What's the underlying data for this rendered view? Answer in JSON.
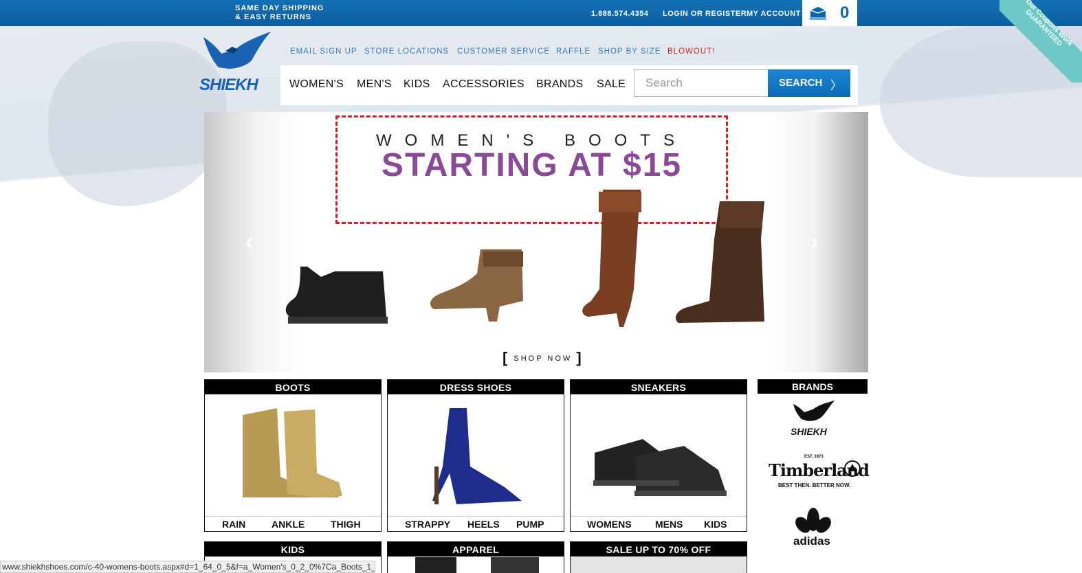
{
  "topbar": {
    "shipping_line1": "SAME DAY SHIPPING",
    "shipping_line2": "& EASY RETURNS",
    "phone": "1.888.574.4354",
    "login": "LOGIN OR REGISTER",
    "account": "MY ACCOUNT",
    "cart_count": "0",
    "ribbon_line1": "Our Coupons Work",
    "ribbon_line2": "GUARANTEED"
  },
  "logo": {
    "text": "SHIEKH",
    "icon": "eagle-icon"
  },
  "utility_links": [
    "EMAIL SIGN UP",
    "STORE LOCATIONS",
    "CUSTOMER SERVICE",
    "RAFFLE",
    "SHOP BY SIZE",
    "BLOWOUT!"
  ],
  "nav": [
    "WOMEN'S",
    "MEN'S",
    "KIDS",
    "ACCESSORIES",
    "BRANDS",
    "SALE"
  ],
  "search": {
    "placeholder": "Search",
    "button": "SEARCH",
    "chevron": "〉"
  },
  "hero": {
    "subtitle": "WOMEN'S BOOTS",
    "title": "STARTING AT $15",
    "cta": "SHOP NOW",
    "prev": "‹",
    "next": "›"
  },
  "categories": [
    {
      "title": "BOOTS",
      "subs": [
        "RAIN",
        "ANKLE",
        "THIGH"
      ]
    },
    {
      "title": "DRESS SHOES",
      "subs": [
        "STRAPPY",
        "HEELS",
        "PUMP"
      ]
    },
    {
      "title": "SNEAKERS",
      "subs": [
        "WOMENS",
        "MENS",
        "KIDS"
      ]
    }
  ],
  "categories_row2": [
    "KIDS",
    "APPAREL",
    "SALE UP TO 70% OFF"
  ],
  "brands": {
    "title": "BRANDS",
    "items": [
      "SHIEKH",
      "Timberland",
      "BEST THEN. BETTER NOW.",
      "EST. 1973",
      "adidas"
    ]
  },
  "status_url": "www.shiekhshoes.com/c-40-womens-boots.aspx#d=1_64_0_5&f=a_Women's_0_2_0%7Ca_Boots_1_40_0",
  "colors": {
    "topbar": "#0b66ad",
    "accent_purple": "#8a4b96",
    "dash_red": "#d81e25",
    "link_blue": "#3d7db7"
  }
}
